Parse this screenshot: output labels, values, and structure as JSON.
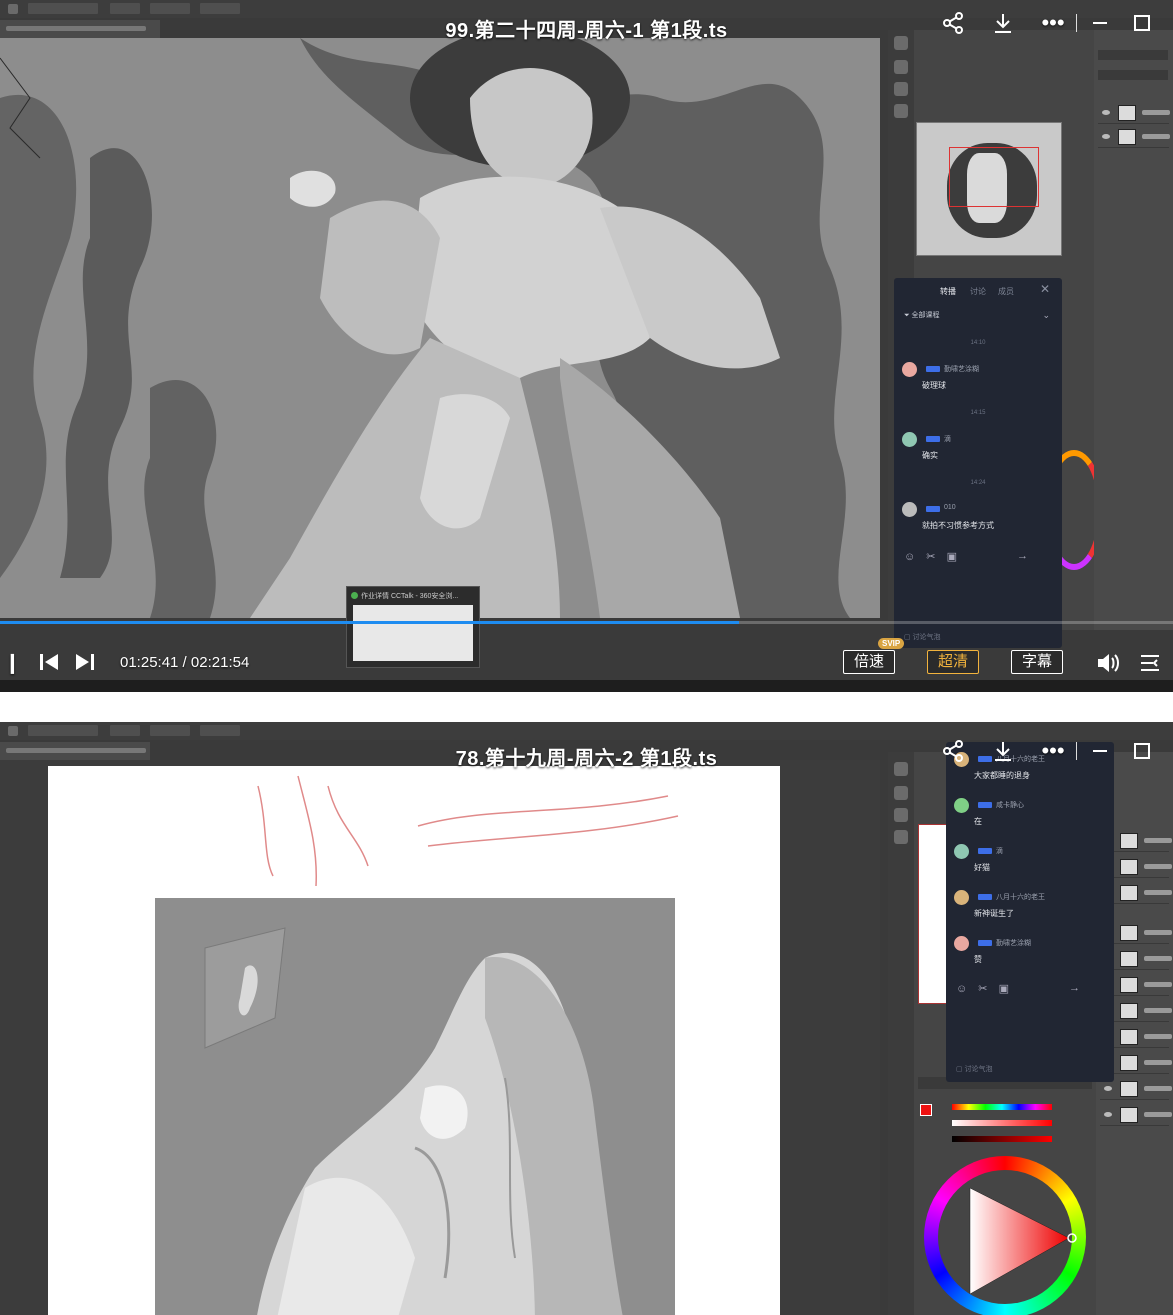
{
  "colors": {
    "progress": "#1e8cf0",
    "highlight": "#f2b33d",
    "chat_bg": "#212633",
    "level_badge": "#3d6ee8"
  },
  "player1": {
    "title": "99.第二十四周-周六-1 第1段.ts",
    "time_current": "01:25:41",
    "time_total": "02:21:54",
    "progress_fraction": 0.63,
    "speed_label": "倍速",
    "speed_badge": "SVIP",
    "quality_label": "超清",
    "subtitle_label": "字幕",
    "chat": {
      "tabs": [
        "转播",
        "讨论",
        "成员"
      ],
      "filter": "全部课程",
      "messages": [
        {
          "time": "14:10",
          "name": "勤啸艺涂糊",
          "text": "破理球"
        },
        {
          "time": "14:15",
          "name": "滴",
          "text": "确实"
        },
        {
          "time": "14:24",
          "name": "010",
          "text": "就拍不习惯参考方式"
        }
      ],
      "footer": "讨论气泡"
    },
    "thumbnail_caption": "作业详情 CCTalk - 360安全浏..."
  },
  "player2": {
    "title": "78.第十九周-周六-2 第1段.ts",
    "chat": {
      "messages": [
        {
          "name": "八月十六的老王",
          "text": "大家都睡的退身"
        },
        {
          "name": "咸卡静心",
          "text": "在"
        },
        {
          "name": "滴",
          "text": "好猫"
        },
        {
          "name": "八月十六的老王",
          "text": "新神诞生了"
        },
        {
          "name": "勤啸艺涂糊",
          "text": "赞"
        }
      ],
      "footer": "讨论气泡"
    }
  },
  "icons": {
    "share": "share-icon",
    "download": "download-icon",
    "more": "more-icon",
    "minimize": "minimize-icon",
    "maximize": "maximize-icon",
    "volume": "volume-icon",
    "playlist": "playlist-icon"
  }
}
